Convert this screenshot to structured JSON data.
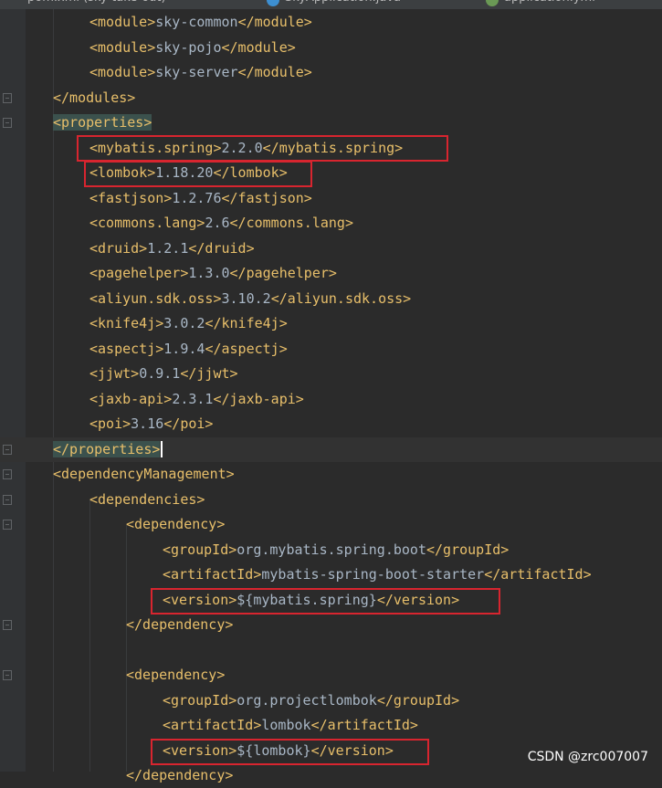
{
  "header": {
    "tabs": [
      "pom.xml (sky-take-out)",
      "SkyApplication.java",
      "application.yml"
    ]
  },
  "colors": {
    "background": "#2b2b2b",
    "tag": "#e8bf6a",
    "text": "#a9b7c6",
    "highlight_box": "#d8252f"
  },
  "editor": {
    "lines": [
      {
        "open": "<module>",
        "text": "sky-common",
        "close": "</module>"
      },
      {
        "open": "<module>",
        "text": "sky-pojo",
        "close": "</module>"
      },
      {
        "open": "<module>",
        "text": "sky-server",
        "close": "</module>"
      },
      {
        "open": "</modules>",
        "text": "",
        "close": ""
      },
      {
        "open": "<properties>",
        "text": "",
        "close": ""
      },
      {
        "open": "<mybatis.spring>",
        "text": "2.2.0",
        "close": "</mybatis.spring>"
      },
      {
        "open": "<lombok>",
        "text": "1.18.20",
        "close": "</lombok>"
      },
      {
        "open": "<fastjson>",
        "text": "1.2.76",
        "close": "</fastjson>"
      },
      {
        "open": "<commons.lang>",
        "text": "2.6",
        "close": "</commons.lang>"
      },
      {
        "open": "<druid>",
        "text": "1.2.1",
        "close": "</druid>"
      },
      {
        "open": "<pagehelper>",
        "text": "1.3.0",
        "close": "</pagehelper>"
      },
      {
        "open": "<aliyun.sdk.oss>",
        "text": "3.10.2",
        "close": "</aliyun.sdk.oss>"
      },
      {
        "open": "<knife4j>",
        "text": "3.0.2",
        "close": "</knife4j>"
      },
      {
        "open": "<aspectj>",
        "text": "1.9.4",
        "close": "</aspectj>"
      },
      {
        "open": "<jjwt>",
        "text": "0.9.1",
        "close": "</jjwt>"
      },
      {
        "open": "<jaxb-api>",
        "text": "2.3.1",
        "close": "</jaxb-api>"
      },
      {
        "open": "<poi>",
        "text": "3.16",
        "close": "</poi>"
      },
      {
        "open": "</properties>",
        "text": "",
        "close": ""
      },
      {
        "open": "<dependencyManagement>",
        "text": "",
        "close": ""
      },
      {
        "open": "<dependencies>",
        "text": "",
        "close": ""
      },
      {
        "open": "<dependency>",
        "text": "",
        "close": ""
      },
      {
        "open": "<groupId>",
        "text": "org.mybatis.spring.boot",
        "close": "</groupId>"
      },
      {
        "open": "<artifactId>",
        "text": "mybatis-spring-boot-starter",
        "close": "</artifactId>"
      },
      {
        "open": "<version>",
        "text": "${mybatis.spring}",
        "close": "</version>"
      },
      {
        "open": "</dependency>",
        "text": "",
        "close": ""
      },
      {
        "open": "",
        "text": "",
        "close": ""
      },
      {
        "open": "<dependency>",
        "text": "",
        "close": ""
      },
      {
        "open": "<groupId>",
        "text": "org.projectlombok",
        "close": "</groupId>"
      },
      {
        "open": "<artifactId>",
        "text": "lombok",
        "close": "</artifactId>"
      },
      {
        "open": "<version>",
        "text": "${lombok}",
        "close": "</version>"
      },
      {
        "open": "</dependency>",
        "text": "",
        "close": ""
      }
    ]
  },
  "watermark": "CSDN @zrc007007"
}
